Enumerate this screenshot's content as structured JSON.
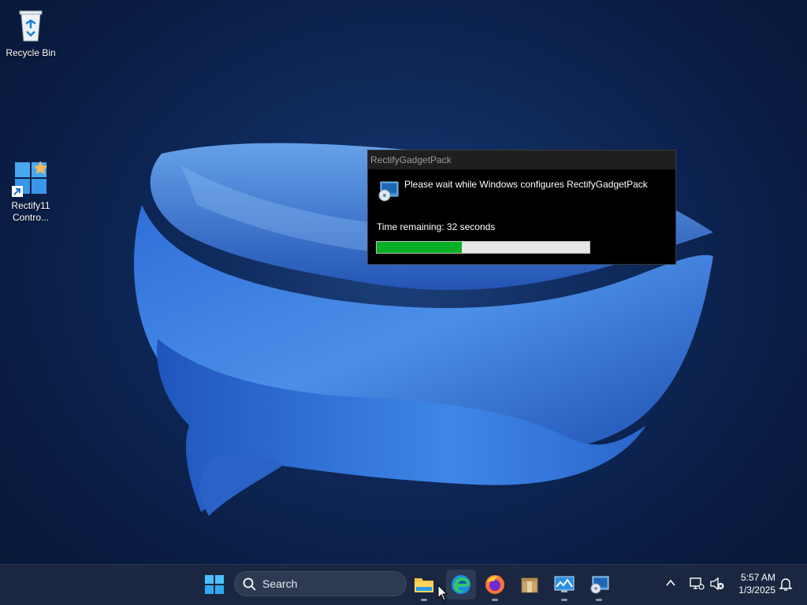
{
  "desktop": {
    "icons": [
      {
        "label": "Recycle Bin",
        "icon": "recycle-bin-icon"
      },
      {
        "label": "Rectify11\nContro...",
        "icon": "rectify11-control-panel-icon"
      }
    ]
  },
  "dialog": {
    "title": "RectifyGadgetPack",
    "message": "Please wait while Windows configures RectifyGadgetPack",
    "time_remaining": "Time remaining: 32 seconds",
    "progress_fraction": 0.4,
    "icon": "installer-disc-icon"
  },
  "taskbar": {
    "search_label": "Search",
    "apps": [
      {
        "name": "start",
        "icon": "windows-start-icon"
      },
      {
        "name": "file-explorer",
        "icon": "folder-icon"
      },
      {
        "name": "edge",
        "icon": "edge-icon"
      },
      {
        "name": "firefox",
        "icon": "firefox-icon"
      },
      {
        "name": "package",
        "icon": "package-icon"
      },
      {
        "name": "control-panel",
        "icon": "monitor-chart-icon"
      },
      {
        "name": "installer",
        "icon": "installer-icon"
      }
    ],
    "tray": {
      "time": "5:57 AM",
      "date": "1/3/2025"
    }
  },
  "colors": {
    "progress_fill": "#06b025",
    "taskbar_bg": "#1b2740"
  }
}
